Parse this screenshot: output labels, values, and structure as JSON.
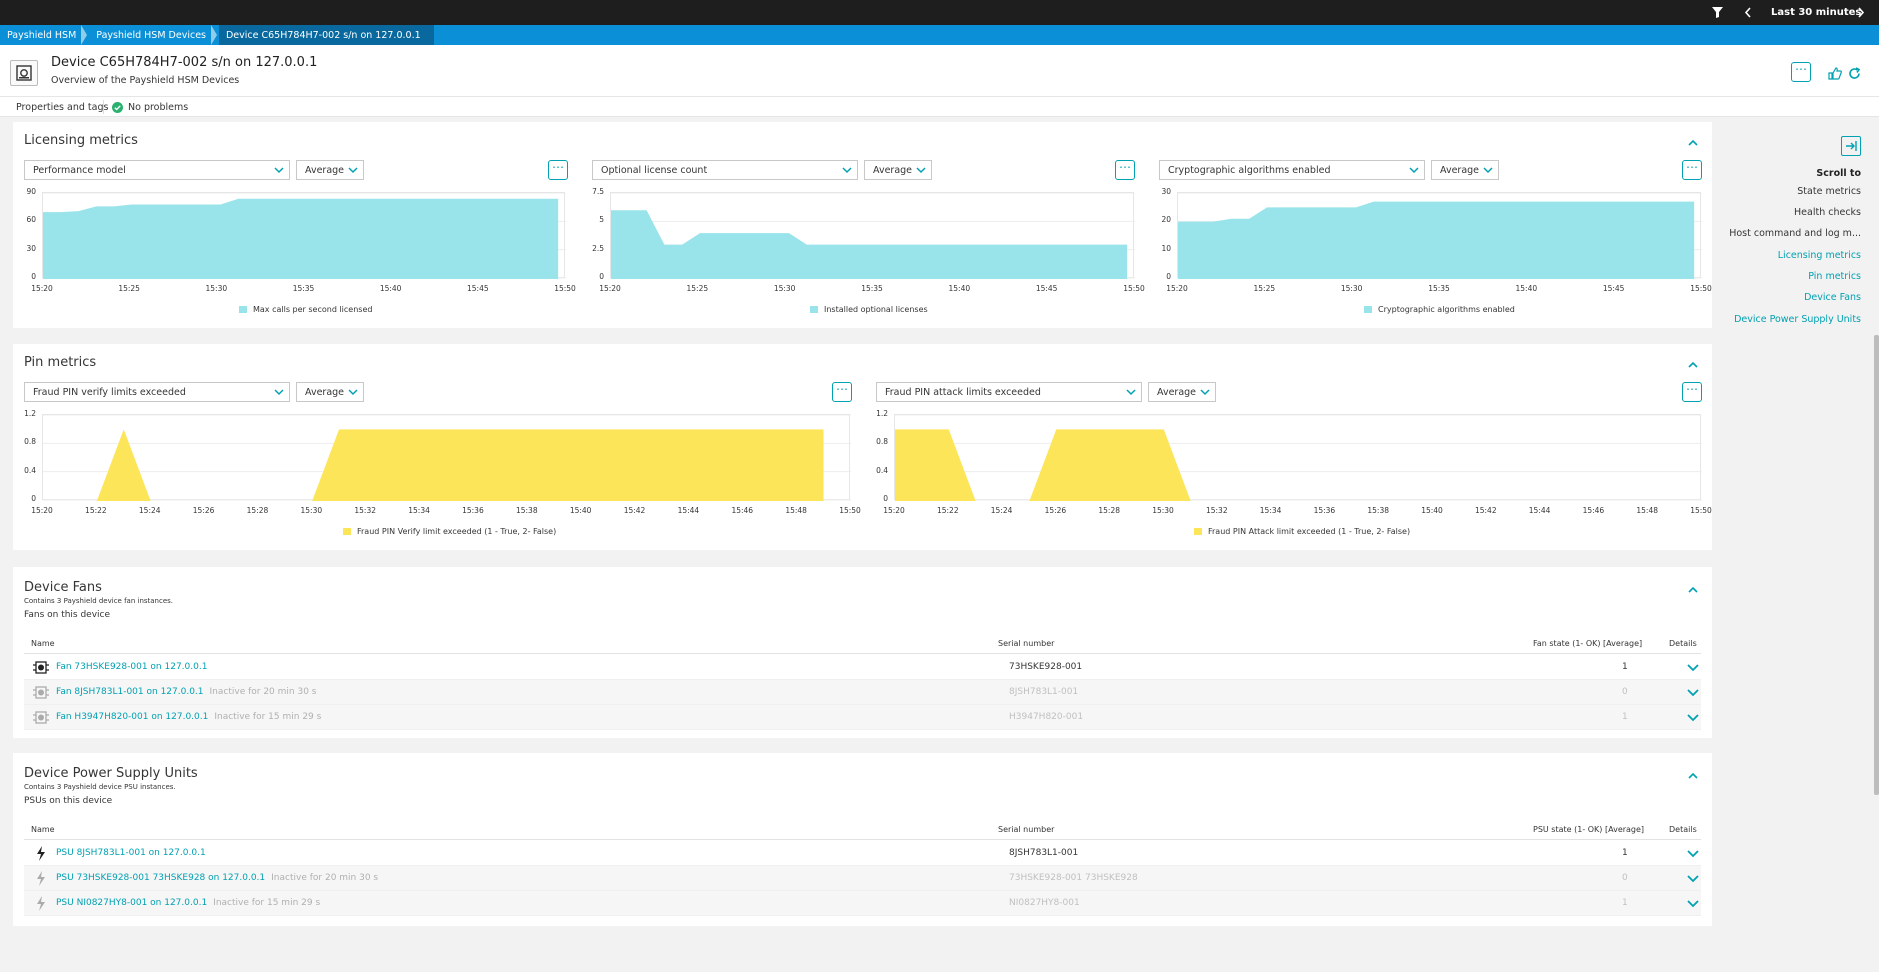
{
  "topbar": {
    "timeframe": "Last 30 minutes"
  },
  "breadcrumb": [
    "Payshield HSM",
    "Payshield HSM Devices",
    "Device C65H784H7-002 s/n on 127.0.0.1"
  ],
  "header": {
    "title": "Device C65H784H7-002 s/n on 127.0.0.1",
    "subtitle": "Overview of the Payshield HSM Devices"
  },
  "subbar": {
    "properties": "Properties and tags",
    "status": "No problems"
  },
  "colors": {
    "cyan_fill": "#98e4ea",
    "yellow_fill": "#fde55a",
    "accent": "#00a1b2",
    "breadcrumb_bg": "#0b8fd6"
  },
  "licensing": {
    "title": "Licensing metrics",
    "charts": [
      {
        "metric": "Performance model",
        "agg": "Average",
        "legend": "Max calls per second licensed",
        "yticks": [
          "90",
          "60",
          "30",
          "0"
        ],
        "ymax": 90,
        "xticks": [
          "15:20",
          "15:25",
          "15:30",
          "15:35",
          "15:40",
          "15:45",
          "15:50"
        ],
        "chart_data": {
          "type": "area",
          "x": [
            "15:20",
            "15:21",
            "15:22",
            "15:23",
            "15:24",
            "15:25",
            "15:26",
            "15:27",
            "15:28",
            "15:29",
            "15:30",
            "15:31",
            "15:32",
            "15:33",
            "15:34",
            "15:35",
            "15:36",
            "15:37",
            "15:38",
            "15:39",
            "15:40",
            "15:41",
            "15:42",
            "15:43",
            "15:44",
            "15:45",
            "15:46",
            "15:47",
            "15:48",
            "15:49"
          ],
          "values": [
            70,
            70,
            71,
            76,
            76,
            78,
            78,
            78,
            78,
            78,
            78,
            84,
            84,
            84,
            84,
            84,
            84,
            84,
            84,
            84,
            84,
            84,
            84,
            84,
            84,
            84,
            84,
            84,
            84,
            84
          ]
        }
      },
      {
        "metric": "Optional license count",
        "agg": "Average",
        "legend": "Installed optional licenses",
        "yticks": [
          "7.5",
          "5",
          "2.5",
          "0"
        ],
        "ymax": 7.5,
        "xticks": [
          "15:20",
          "15:25",
          "15:30",
          "15:35",
          "15:40",
          "15:45",
          "15:50"
        ],
        "chart_data": {
          "type": "area",
          "x": [
            "15:20",
            "15:21",
            "15:22",
            "15:23",
            "15:24",
            "15:25",
            "15:26",
            "15:27",
            "15:28",
            "15:29",
            "15:30",
            "15:31",
            "15:32",
            "15:33",
            "15:34",
            "15:35",
            "15:36",
            "15:37",
            "15:38",
            "15:39",
            "15:40",
            "15:41",
            "15:42",
            "15:43",
            "15:44",
            "15:45",
            "15:46",
            "15:47",
            "15:48",
            "15:49"
          ],
          "values": [
            6,
            6,
            6,
            3,
            3,
            4,
            4,
            4,
            4,
            4,
            4,
            3,
            3,
            3,
            3,
            3,
            3,
            3,
            3,
            3,
            3,
            3,
            3,
            3,
            3,
            3,
            3,
            3,
            3,
            3
          ]
        }
      },
      {
        "metric": "Cryptographic algorithms enabled",
        "agg": "Average",
        "legend": "Cryptographic algorithms enabled",
        "yticks": [
          "30",
          "20",
          "10",
          "0"
        ],
        "ymax": 30,
        "xticks": [
          "15:20",
          "15:25",
          "15:30",
          "15:35",
          "15:40",
          "15:45",
          "15:50"
        ],
        "chart_data": {
          "type": "area",
          "x": [
            "15:20",
            "15:21",
            "15:22",
            "15:23",
            "15:24",
            "15:25",
            "15:26",
            "15:27",
            "15:28",
            "15:29",
            "15:30",
            "15:31",
            "15:32",
            "15:33",
            "15:34",
            "15:35",
            "15:36",
            "15:37",
            "15:38",
            "15:39",
            "15:40",
            "15:41",
            "15:42",
            "15:43",
            "15:44",
            "15:45",
            "15:46",
            "15:47",
            "15:48",
            "15:49"
          ],
          "values": [
            20,
            20,
            20,
            21,
            21,
            25,
            25,
            25,
            25,
            25,
            25,
            27,
            27,
            27,
            27,
            27,
            27,
            27,
            27,
            27,
            27,
            27,
            27,
            27,
            27,
            27,
            27,
            27,
            27,
            27
          ]
        }
      }
    ]
  },
  "pin": {
    "title": "Pin metrics",
    "charts": [
      {
        "metric": "Fraud PIN verify limits exceeded",
        "agg": "Average",
        "legend": "Fraud PIN Verify limit exceeded (1 - True, 2- False)",
        "yticks": [
          "1.2",
          "0.8",
          "0.4",
          "0"
        ],
        "ymax": 1.2,
        "xticks": [
          "15:20",
          "15:22",
          "15:24",
          "15:26",
          "15:28",
          "15:30",
          "15:32",
          "15:34",
          "15:36",
          "15:38",
          "15:40",
          "15:42",
          "15:44",
          "15:46",
          "15:48",
          "15:50"
        ],
        "chart_data": {
          "type": "area",
          "x": [
            "15:20",
            "15:21",
            "15:22",
            "15:23",
            "15:24",
            "15:25",
            "15:26",
            "15:27",
            "15:28",
            "15:29",
            "15:30",
            "15:31",
            "15:32",
            "15:33",
            "15:34",
            "15:35",
            "15:36",
            "15:37",
            "15:38",
            "15:39",
            "15:40",
            "15:41",
            "15:42",
            "15:43",
            "15:44",
            "15:45",
            "15:46",
            "15:47",
            "15:48",
            "15:49"
          ],
          "values": [
            0,
            0,
            0,
            1,
            0,
            0,
            0,
            0,
            0,
            0,
            0,
            1,
            1,
            1,
            1,
            1,
            1,
            1,
            1,
            1,
            1,
            1,
            1,
            1,
            1,
            1,
            1,
            1,
            1,
            1
          ]
        }
      },
      {
        "metric": "Fraud PIN attack limits exceeded",
        "agg": "Average",
        "legend": "Fraud PIN Attack limit exceeded (1 - True, 2- False)",
        "yticks": [
          "1.2",
          "0.8",
          "0.4",
          "0"
        ],
        "ymax": 1.2,
        "xticks": [
          "15:20",
          "15:22",
          "15:24",
          "15:26",
          "15:28",
          "15:30",
          "15:32",
          "15:34",
          "15:36",
          "15:38",
          "15:40",
          "15:42",
          "15:44",
          "15:46",
          "15:48",
          "15:50"
        ],
        "chart_data": {
          "type": "area",
          "x": [
            "15:20",
            "15:21",
            "15:22",
            "15:23",
            "15:24",
            "15:25",
            "15:26",
            "15:27",
            "15:28",
            "15:29",
            "15:30",
            "15:31",
            "15:32",
            "15:33",
            "15:34",
            "15:35",
            "15:36",
            "15:37",
            "15:38",
            "15:39",
            "15:40",
            "15:41",
            "15:42",
            "15:43",
            "15:44",
            "15:45",
            "15:46",
            "15:47",
            "15:48",
            "15:49"
          ],
          "values": [
            1,
            1,
            1,
            0,
            0,
            0,
            1,
            1,
            1,
            1,
            1,
            0,
            0,
            0,
            0,
            0,
            0,
            0,
            0,
            0,
            0,
            0,
            0,
            0,
            0,
            0,
            0,
            0,
            0,
            0
          ]
        }
      }
    ]
  },
  "fans": {
    "title": "Device Fans",
    "desc": "Contains 3 Payshield device fan instances.",
    "sub": "Fans on this device",
    "cols": [
      "Name",
      "Serial number",
      "Fan state (1- OK) [Average]",
      "Details"
    ],
    "rows": [
      {
        "name": "Fan 73HSKE928-001 on 127.0.0.1",
        "inactive": "",
        "serial": "73HSKE928-001",
        "value": "1"
      },
      {
        "name": "Fan 8JSH783L1-001 on 127.0.0.1",
        "inactive": "Inactive for 20 min 30 s",
        "serial": "8JSH783L1-001",
        "value": "0"
      },
      {
        "name": "Fan H3947H820-001 on 127.0.0.1",
        "inactive": "Inactive for 15 min 29 s",
        "serial": "H3947H820-001",
        "value": "1"
      }
    ]
  },
  "psus": {
    "title": "Device Power Supply Units",
    "desc": "Contains 3 Payshield device PSU instances.",
    "sub": "PSUs on this device",
    "cols": [
      "Name",
      "Serial number",
      "PSU state (1- OK) [Average]",
      "Details"
    ],
    "rows": [
      {
        "name": "PSU 8JSH783L1-001 on 127.0.0.1",
        "inactive": "",
        "serial": "8JSH783L1-001",
        "value": "1"
      },
      {
        "name": "PSU 73HSKE928-001 73HSKE928 on 127.0.0.1",
        "inactive": "Inactive for 20 min 30 s",
        "serial": "73HSKE928-001 73HSKE928",
        "value": "0"
      },
      {
        "name": "PSU NI0827HY8-001 on 127.0.0.1",
        "inactive": "Inactive for 15 min 29 s",
        "serial": "NI0827HY8-001",
        "value": "1"
      }
    ]
  },
  "scrollto": {
    "title": "Scroll to",
    "items": [
      "State metrics",
      "Health checks",
      "Host command and log m...",
      "Licensing metrics",
      "Pin metrics",
      "Device Fans",
      "Device Power Supply Units"
    ]
  }
}
